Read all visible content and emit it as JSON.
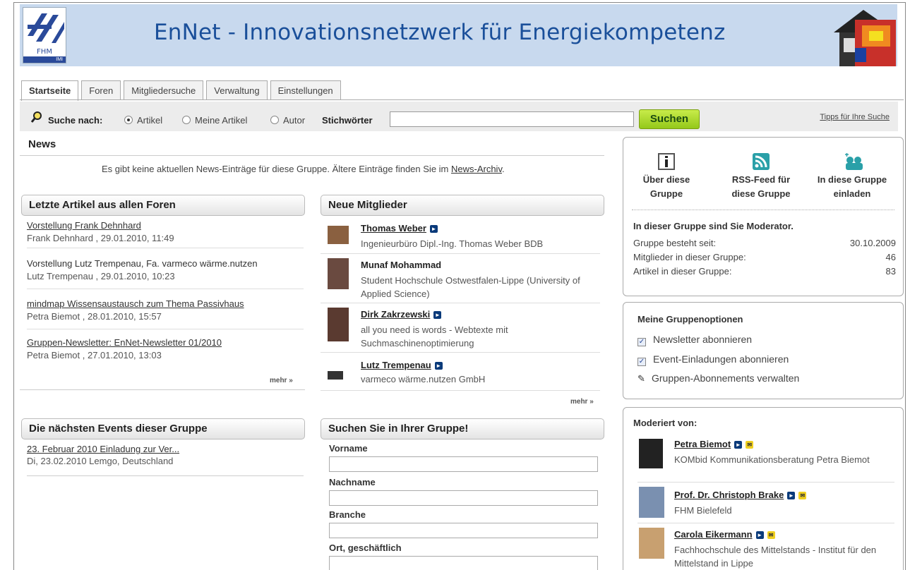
{
  "banner": {
    "title": "EnNet - Innovationsnetzwerk für Energiekompetenz",
    "logo_text": "FHM",
    "logo_sub": "IMI"
  },
  "tabs": [
    {
      "label": "Startseite",
      "active": true
    },
    {
      "label": "Foren"
    },
    {
      "label": "Mitgliedersuche"
    },
    {
      "label": "Verwaltung"
    },
    {
      "label": "Einstellungen"
    }
  ],
  "search": {
    "label": "Suche nach:",
    "options": [
      "Artikel",
      "Meine Artikel",
      "Autor"
    ],
    "selected": "Artikel",
    "keyword_label": "Stichwörter",
    "keyword_value": "",
    "button": "Suchen",
    "tips": "Tipps für Ihre Suche"
  },
  "news": {
    "heading": "News",
    "text": "Es gibt keine aktuellen News-Einträge für diese Gruppe. Ältere Einträge finden Sie im ",
    "link": "News-Archiv",
    "end": "."
  },
  "articles": {
    "heading": "Letzte Artikel aus allen Foren",
    "items": [
      {
        "title": "Vorstellung Frank Dehnhard",
        "meta": "Frank Dehnhard , 29.01.2010, 11:49"
      },
      {
        "title": "Vorstellung Lutz Trempenau, Fa. varmeco wärme.nutzen",
        "meta": "Lutz Trempenau , 29.01.2010, 10:23"
      },
      {
        "title": "mindmap Wissensaustausch zum Thema Passivhaus",
        "meta": "Petra Biemot , 28.01.2010, 15:57"
      },
      {
        "title": "Gruppen-Newsletter: EnNet-Newsletter 01/2010",
        "meta": "Petra Biemot , 27.01.2010, 13:03"
      }
    ],
    "more": "mehr »"
  },
  "members": {
    "heading": "Neue Mitglieder",
    "items": [
      {
        "name": "Thomas Weber",
        "desc": "Ingenieurbüro Dipl.-Ing. Thomas Weber BDB"
      },
      {
        "name": "Munaf Mohammad",
        "desc": "Student Hochschule Ostwestfalen-Lippe (University of Applied Science)"
      },
      {
        "name": "Dirk Zakrzewski",
        "desc": "all you need is words - Webtexte mit Suchmaschinenoptimierung"
      },
      {
        "name": "Lutz Trempenau",
        "desc": "varmeco wärme.nutzen GmbH"
      }
    ],
    "more": "mehr »"
  },
  "events": {
    "heading": "Die nächsten Events dieser Gruppe",
    "items": [
      {
        "title": "23. Februar 2010 Einladung zur Ver...",
        "meta": "Di, 23.02.2010 Lemgo, Deutschland"
      }
    ]
  },
  "group_search": {
    "heading": "Suchen Sie in Ihrer Gruppe!",
    "fields": [
      "Vorname",
      "Nachname",
      "Branche",
      "Ort, geschäftlich"
    ]
  },
  "group_info": {
    "actions": [
      {
        "line1": "Über diese",
        "line2": "Gruppe"
      },
      {
        "line1": "RSS-Feed für",
        "line2": "diese Gruppe"
      },
      {
        "line1": "In diese Gruppe",
        "line2": "einladen"
      }
    ],
    "moderator_note": "In dieser Gruppe sind Sie Moderator.",
    "stats": [
      {
        "label": "Gruppe besteht seit:",
        "value": "30.10.2009"
      },
      {
        "label": "Mitglieder in dieser Gruppe:",
        "value": "46"
      },
      {
        "label": "Artikel in dieser Gruppe:",
        "value": "83"
      }
    ]
  },
  "options": {
    "heading": "Meine Gruppenoptionen",
    "items": [
      {
        "label": "Newsletter abonnieren",
        "checked": true
      },
      {
        "label": "Event-Einladungen abonnieren",
        "checked": true
      }
    ],
    "manage": "Gruppen-Abonnements verwalten"
  },
  "moderators": {
    "heading": "Moderiert von:",
    "items": [
      {
        "name": "Petra Biemot",
        "desc": "KOMbid Kommunikationsberatung Petra Biemot"
      },
      {
        "name": "Prof. Dr. Christoph Brake",
        "desc": "FHM Bielefeld"
      },
      {
        "name": "Carola Eikermann",
        "desc": "Fachhochschule des Mittelstands - Institut für den Mittelstand in Lippe"
      }
    ]
  },
  "colors": {
    "accent": "#1a4f9a",
    "button": "#a6d628",
    "banner": "#c8d9ee"
  }
}
